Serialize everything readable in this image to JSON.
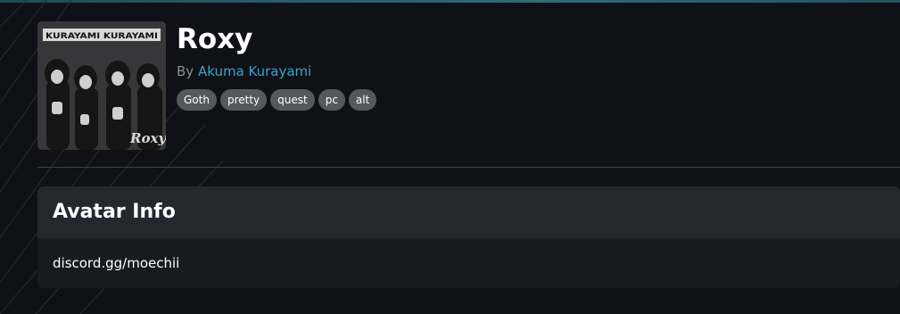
{
  "avatar": {
    "title": "Roxy",
    "byline_prefix": "By",
    "author": "Akuma Kurayami",
    "thumbnail_alt": "Roxy avatar thumbnail",
    "thumbnail_banner_text": "KURAYAMI KURAYAMI",
    "thumbnail_signature": "Roxy",
    "tags": [
      "Goth",
      "pretty",
      "quest",
      "pc",
      "alt"
    ]
  },
  "info": {
    "heading": "Avatar Info",
    "description": "discord.gg/moechii"
  },
  "colors": {
    "background": "#101116",
    "accent_link": "#39a4c6",
    "tag_background": "#56585d",
    "card_header": "#24272d",
    "card_body": "#181a1f"
  }
}
